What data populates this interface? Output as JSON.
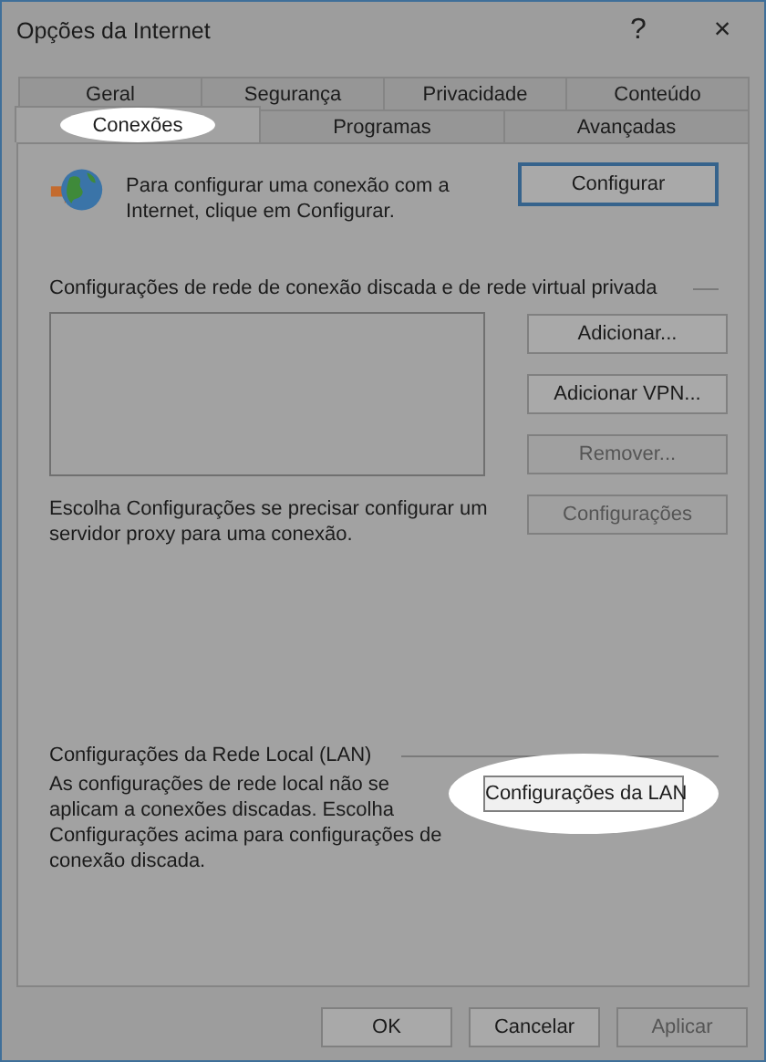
{
  "window": {
    "title": "Opções da Internet",
    "help": "?",
    "close": "×"
  },
  "tab_rows": [
    [
      {
        "label": "Geral",
        "selected": false,
        "highlighted": false
      },
      {
        "label": "Segurança",
        "selected": false,
        "highlighted": false
      },
      {
        "label": "Privacidade",
        "selected": false,
        "highlighted": false
      },
      {
        "label": "Conteúdo",
        "selected": false,
        "highlighted": false
      }
    ],
    [
      {
        "label": "Conexões",
        "selected": true,
        "highlighted": true
      },
      {
        "label": "Programas",
        "selected": false,
        "highlighted": false
      },
      {
        "label": "Avançadas",
        "selected": false,
        "highlighted": false
      }
    ]
  ],
  "setup": {
    "text": "Para configurar uma conexão com a Internet, clique em Configurar.",
    "button": {
      "label": "Configurar",
      "focused": true
    }
  },
  "dialup": {
    "heading": "Configurações de rede de conexão discada e de rede virtual privada",
    "buttons": [
      {
        "label": "Adicionar...",
        "disabled": false
      },
      {
        "label": "Adicionar VPN...",
        "disabled": false
      },
      {
        "label": "Remover...",
        "disabled": true
      },
      {
        "label": "Configurações",
        "disabled": true
      }
    ],
    "proxy_text": "Escolha Configurações se precisar configurar um servidor proxy para uma conexão."
  },
  "lan": {
    "heading": "Configurações da Rede Local (LAN)",
    "text": "As configurações de rede local não se aplicam a conexões discadas. Escolha Configurações acima para configurações de conexão discada.",
    "button": {
      "label": "Configurações da LAN",
      "highlighted": true
    }
  },
  "buttons": [
    {
      "label": "OK",
      "disabled": false
    },
    {
      "label": "Cancelar",
      "disabled": false
    },
    {
      "label": "Aplicar",
      "disabled": true
    }
  ]
}
